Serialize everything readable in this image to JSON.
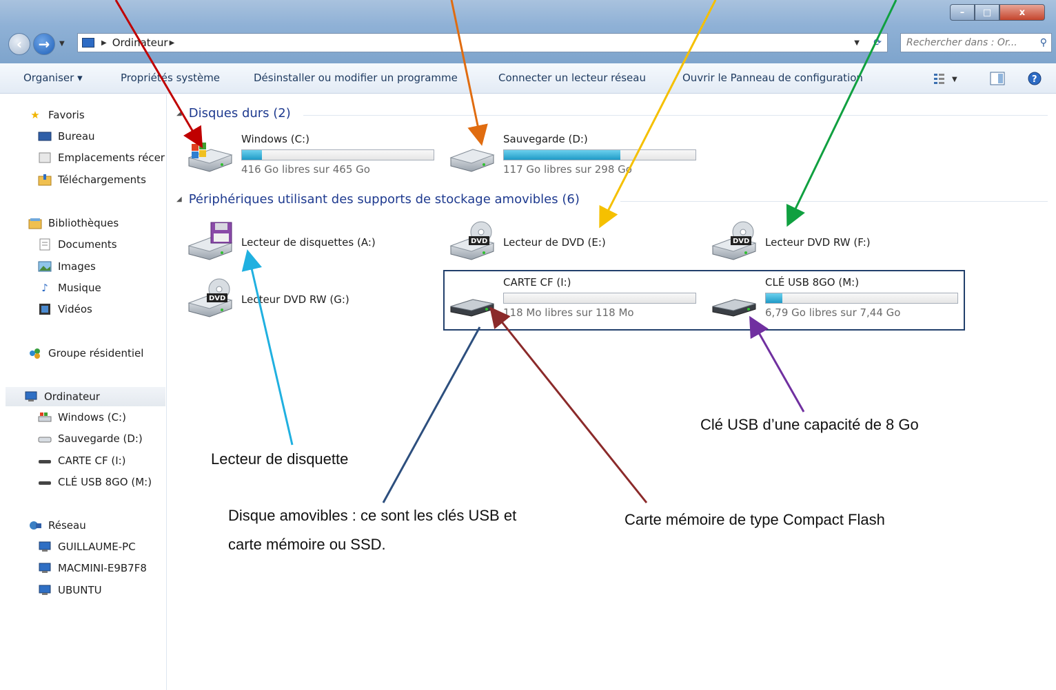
{
  "address": {
    "crumb": "Ordinateur"
  },
  "search": {
    "placeholder": "Rechercher dans : Or..."
  },
  "window_controls": {
    "minimize": "–",
    "maximize": "□",
    "close": "x"
  },
  "toolbar": {
    "organize": "Organiser ▾",
    "system_props": "Propriétés système",
    "uninstall": "Désinstaller ou modifier un programme",
    "map_drive": "Connecter un lecteur réseau",
    "control_panel": "Ouvrir le Panneau de configuration"
  },
  "sidebar": {
    "favorites": "Favoris",
    "desktop": "Bureau",
    "recent": "Emplacements récer",
    "downloads": "Téléchargements",
    "libraries": "Bibliothèques",
    "documents": "Documents",
    "images": "Images",
    "music": "Musique",
    "videos": "Vidéos",
    "homegroup": "Groupe résidentiel",
    "computer": "Ordinateur",
    "windows_c": "Windows (C:)",
    "sauvegarde_d": "Sauvegarde (D:)",
    "carte_i": "CARTE CF (I:)",
    "usb_m": "CLÉ USB 8GO (M:)",
    "network": "Réseau",
    "net1": "GUILLAUME-PC",
    "net2": "MACMINI-E9B7F8",
    "net3": "UBUNTU"
  },
  "sections": {
    "hard_drives": "Disques durs (2)",
    "removable": "Périphériques utilisant des supports de stockage amovibles (6)"
  },
  "drives": {
    "c": {
      "name": "Windows (C:)",
      "space": "416 Go libres sur 465 Go",
      "used_fraction": 0.105
    },
    "d": {
      "name": "Sauvegarde (D:)",
      "space": "117 Go libres sur 298 Go",
      "used_fraction": 0.607
    },
    "a": {
      "name": "Lecteur de disquettes (A:)"
    },
    "e": {
      "name": "Lecteur de DVD (E:)"
    },
    "f": {
      "name": "Lecteur DVD RW (F:)"
    },
    "g": {
      "name": "Lecteur DVD RW (G:)"
    },
    "i": {
      "name": "CARTE CF (I:)",
      "space": "118 Mo libres sur 118 Mo",
      "used_fraction": 0.0
    },
    "m": {
      "name": "CLÉ USB 8GO (M:)",
      "space": "6,79 Go libres sur 7,44 Go",
      "used_fraction": 0.087
    }
  },
  "annotations": {
    "usb": "Clé USB d’une capacité de 8 Go",
    "floppy": "Lecteur de disquette",
    "removable_line1": "Disque amovibles : ce sont les clés USB et",
    "removable_line2": "carte mémoire ou SSD.",
    "cf": "Carte mémoire de type Compact Flash"
  },
  "dvd_badge": "DVD",
  "colors": {
    "bar_fill": "#1f9ac7",
    "arrow_red": "#c00000",
    "arrow_orange": "#e06c10",
    "arrow_yellow": "#f5c000",
    "arrow_green": "#10a040",
    "arrow_cyan": "#20b0e0",
    "arrow_blue": "#2d4f7e",
    "arrow_brown": "#8b2a2a",
    "arrow_purple": "#7030a0"
  }
}
